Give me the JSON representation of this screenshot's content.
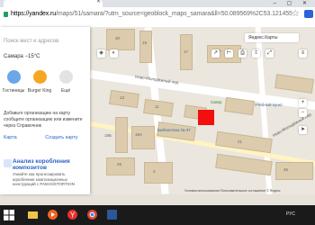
{
  "browser": {
    "url_host": "https://yandex.ru",
    "url_rest": "/maps/51/samara/?utm_source=geoblock_maps_samara&ll=50.089569%2C53.121455"
  },
  "sidebar": {
    "search_placeholder": "Поиск мест и адресов",
    "weather": "Самара −15°C",
    "categories": [
      "Гостиницы",
      "Burger King",
      "Ещё"
    ],
    "promo_text": "Добавьте организацию на карту сообщите организацию или измените через Справочник",
    "link_left": "Карта",
    "link_right": "Создать карту",
    "ad_title": "Анализ коробления композитов",
    "ad_text": "Узнайте как прогнозировать коробление композиционных конструкций с PAM-DISTORTION"
  },
  "map": {
    "badge": "Яндекс.Карты",
    "streets": [
      "Ново-Молодёжный пер.",
      "Ново-Молодёжный пер."
    ],
    "place_library": "Библиотека № 37",
    "place_park": "Сквер",
    "place_shop": "Учебный пункт",
    "building_numbers": [
      "30",
      "15",
      "17",
      "19",
      "13",
      "11",
      "21",
      "26",
      "3",
      "45",
      "19А",
      "19Б"
    ],
    "copyright": "Условия использования  Пользовательское соглашение  © Яндекс"
  },
  "taskbar": {
    "tray_lang": "РУС"
  },
  "colors": {
    "accent_red": "#f20f0f",
    "link_blue": "#2b63c4"
  }
}
